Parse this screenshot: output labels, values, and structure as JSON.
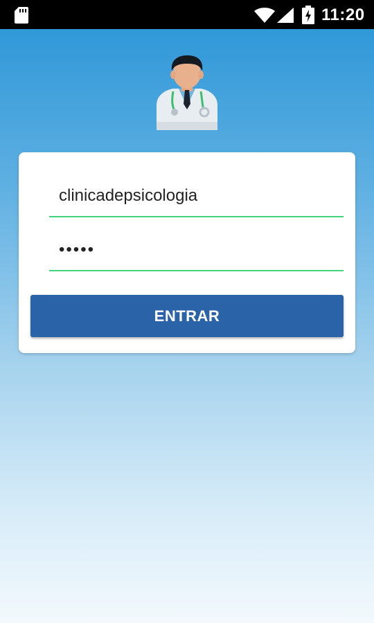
{
  "status_bar": {
    "time": "11:20",
    "icons": [
      "sd-card-icon",
      "wifi-icon",
      "signal-icon",
      "battery-icon"
    ]
  },
  "header": {
    "avatar_icon": "doctor-avatar-icon"
  },
  "login_form": {
    "username_value": "clinicadepsicologia",
    "password_value": "•••••",
    "submit_label": "ENTRAR"
  },
  "colors": {
    "button": "#2b63a8",
    "field_underline": "#3fd37a",
    "gradient_top": "#2894d6",
    "gradient_bottom": "#f3f9fd"
  }
}
